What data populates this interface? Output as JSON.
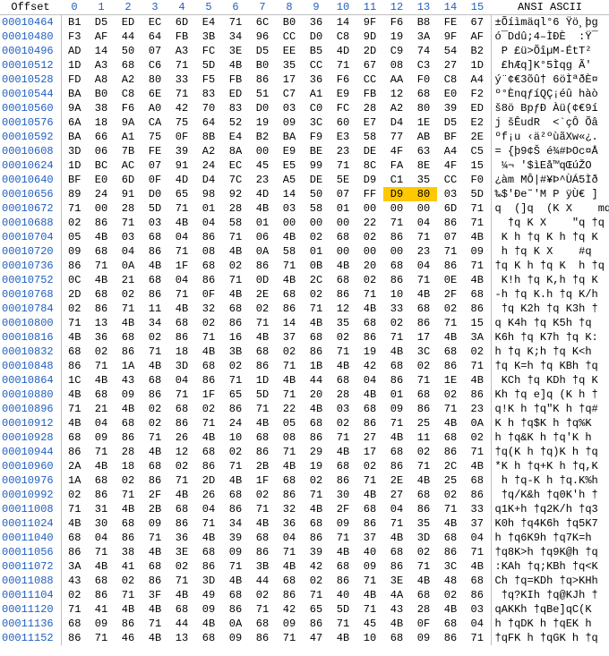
{
  "header": {
    "offset_label": "Offset",
    "columns": [
      "0",
      "1",
      "2",
      "3",
      "4",
      "5",
      "6",
      "7",
      "8",
      "9",
      "10",
      "11",
      "12",
      "13",
      "14",
      "15"
    ],
    "ascii_label": "ANSI ASCII"
  },
  "selection": {
    "row": 12,
    "cols": [
      12,
      13
    ]
  },
  "rows": [
    {
      "offset": "00010464",
      "hex": [
        "B1",
        "D5",
        "ED",
        "EC",
        "6D",
        "E4",
        "71",
        "6C",
        "B0",
        "36",
        "14",
        "9F",
        "F6",
        "B8",
        "FE",
        "67"
      ],
      "ascii": "±Õíìmäql°6 Ÿö¸þg"
    },
    {
      "offset": "00010480",
      "hex": [
        "F3",
        "AF",
        "44",
        "64",
        "FB",
        "3B",
        "34",
        "96",
        "CC",
        "D0",
        "C8",
        "9D",
        "19",
        "3A",
        "9F",
        "AF"
      ],
      "ascii": "ó¯Ddû;4–ÌÐÈ  :Ÿ¯"
    },
    {
      "offset": "00010496",
      "hex": [
        "AD",
        "14",
        "50",
        "07",
        "A3",
        "FC",
        "3E",
        "D5",
        "EE",
        "B5",
        "4D",
        "2D",
        "C9",
        "74",
        "54",
        "B2"
      ],
      "ascii": "­ P £ü>ÕîµM-ÉtT²"
    },
    {
      "offset": "00010512",
      "hex": [
        "1D",
        "A3",
        "68",
        "C6",
        "71",
        "5D",
        "4B",
        "B0",
        "35",
        "CC",
        "71",
        "67",
        "08",
        "C3",
        "27",
        "1D"
      ],
      "ascii": " £hÆq]K°5Ìqg Ã' "
    },
    {
      "offset": "00010528",
      "hex": [
        "FD",
        "A8",
        "A2",
        "80",
        "33",
        "F5",
        "FB",
        "86",
        "17",
        "36",
        "F6",
        "CC",
        "AA",
        "F0",
        "C8",
        "A4"
      ],
      "ascii": "ý¨¢€3õû† 6öÌªðÈ¤"
    },
    {
      "offset": "00010544",
      "hex": [
        "BA",
        "B0",
        "C8",
        "6E",
        "71",
        "83",
        "ED",
        "51",
        "C7",
        "A1",
        "E9",
        "FB",
        "12",
        "68",
        "E0",
        "F2"
      ],
      "ascii": "º°ÈnqƒíQÇ¡éû hàò"
    },
    {
      "offset": "00010560",
      "hex": [
        "9A",
        "38",
        "F6",
        "A0",
        "42",
        "70",
        "83",
        "D0",
        "03",
        "C0",
        "FC",
        "28",
        "A2",
        "80",
        "39",
        "ED"
      ],
      "ascii": "š8ö BpƒÐ Àü(¢€9í"
    },
    {
      "offset": "00010576",
      "hex": [
        "6A",
        "18",
        "9A",
        "CA",
        "75",
        "64",
        "52",
        "19",
        "09",
        "3C",
        "60",
        "E7",
        "D4",
        "1E",
        "D5",
        "E2"
      ],
      "ascii": "j šÊudR  <`çÔ Õâ"
    },
    {
      "offset": "00010592",
      "hex": [
        "BA",
        "66",
        "A1",
        "75",
        "0F",
        "8B",
        "E4",
        "B2",
        "BA",
        "F9",
        "E3",
        "58",
        "77",
        "AB",
        "BF",
        "2E"
      ],
      "ascii": "ºf¡u ‹ä²ºùãXw«¿."
    },
    {
      "offset": "00010608",
      "hex": [
        "3D",
        "06",
        "7B",
        "FE",
        "39",
        "A2",
        "8A",
        "00",
        "E9",
        "BE",
        "23",
        "DE",
        "4F",
        "63",
        "A4",
        "C5"
      ],
      "ascii": "= {þ9¢Š é¾#ÞOc¤Å"
    },
    {
      "offset": "00010624",
      "hex": [
        "1D",
        "BC",
        "AC",
        "07",
        "91",
        "24",
        "EC",
        "45",
        "E5",
        "99",
        "71",
        "8C",
        "FA",
        "8E",
        "4F",
        "15"
      ],
      "ascii": " ¼¬ '$ìEå™qŒúŽO "
    },
    {
      "offset": "00010640",
      "hex": [
        "BF",
        "E0",
        "6D",
        "0F",
        "4D",
        "D4",
        "7C",
        "23",
        "A5",
        "DE",
        "5E",
        "D9",
        "C1",
        "35",
        "CC",
        "F0"
      ],
      "ascii": "¿àm MÔ|#¥Þ^ÙÁ5Ìð"
    },
    {
      "offset": "00010656",
      "hex": [
        "89",
        "24",
        "91",
        "D0",
        "65",
        "98",
        "92",
        "4D",
        "14",
        "50",
        "07",
        "FF",
        "D9",
        "80",
        "03",
        "5D"
      ],
      "ascii": "‰$'Ðe˜'M P ÿÙ€ ]"
    },
    {
      "offset": "00010672",
      "hex": [
        "71",
        "00",
        "28",
        "5D",
        "71",
        "01",
        "28",
        "4B",
        "03",
        "58",
        "01",
        "00",
        "00",
        "00",
        "6D",
        "71"
      ],
      "ascii": "q  (]q  (K X    mq"
    },
    {
      "offset": "00010688",
      "hex": [
        "02",
        "86",
        "71",
        "03",
        "4B",
        "04",
        "58",
        "01",
        "00",
        "00",
        "00",
        "22",
        "71",
        "04",
        "86",
        "71"
      ],
      "ascii": "  †q K X    \"q †q"
    },
    {
      "offset": "00010704",
      "hex": [
        "05",
        "4B",
        "03",
        "68",
        "04",
        "86",
        "71",
        "06",
        "4B",
        "02",
        "68",
        "02",
        "86",
        "71",
        "07",
        "4B"
      ],
      "ascii": " K h †q K h †q K"
    },
    {
      "offset": "00010720",
      "hex": [
        "09",
        "68",
        "04",
        "86",
        "71",
        "08",
        "4B",
        "0A",
        "58",
        "01",
        "00",
        "00",
        "00",
        "23",
        "71",
        "09"
      ],
      "ascii": " h †q K X    #q "
    },
    {
      "offset": "00010736",
      "hex": [
        "86",
        "71",
        "0A",
        "4B",
        "1F",
        "68",
        "02",
        "86",
        "71",
        "0B",
        "4B",
        "20",
        "68",
        "04",
        "86",
        "71"
      ],
      "ascii": "†q K h †q K  h †q"
    },
    {
      "offset": "00010752",
      "hex": [
        "0C",
        "4B",
        "21",
        "68",
        "04",
        "86",
        "71",
        "0D",
        "4B",
        "2C",
        "68",
        "02",
        "86",
        "71",
        "0E",
        "4B"
      ],
      "ascii": " K!h †q K,h †q K"
    },
    {
      "offset": "00010768",
      "hex": [
        "2D",
        "68",
        "02",
        "86",
        "71",
        "0F",
        "4B",
        "2E",
        "68",
        "02",
        "86",
        "71",
        "10",
        "4B",
        "2F",
        "68"
      ],
      "ascii": "-h †q K.h †q K/h"
    },
    {
      "offset": "00010784",
      "hex": [
        "02",
        "86",
        "71",
        "11",
        "4B",
        "32",
        "68",
        "02",
        "86",
        "71",
        "12",
        "4B",
        "33",
        "68",
        "02",
        "86"
      ],
      "ascii": " †q K2h †q K3h †"
    },
    {
      "offset": "00010800",
      "hex": [
        "71",
        "13",
        "4B",
        "34",
        "68",
        "02",
        "86",
        "71",
        "14",
        "4B",
        "35",
        "68",
        "02",
        "86",
        "71",
        "15"
      ],
      "ascii": "q K4h †q K5h †q "
    },
    {
      "offset": "00010816",
      "hex": [
        "4B",
        "36",
        "68",
        "02",
        "86",
        "71",
        "16",
        "4B",
        "37",
        "68",
        "02",
        "86",
        "71",
        "17",
        "4B",
        "3A"
      ],
      "ascii": "K6h †q K7h †q K:"
    },
    {
      "offset": "00010832",
      "hex": [
        "68",
        "02",
        "86",
        "71",
        "18",
        "4B",
        "3B",
        "68",
        "02",
        "86",
        "71",
        "19",
        "4B",
        "3C",
        "68",
        "02"
      ],
      "ascii": "h †q K;h †q K<h "
    },
    {
      "offset": "00010848",
      "hex": [
        "86",
        "71",
        "1A",
        "4B",
        "3D",
        "68",
        "02",
        "86",
        "71",
        "1B",
        "4B",
        "42",
        "68",
        "02",
        "86",
        "71"
      ],
      "ascii": "†q K=h †q KBh †q"
    },
    {
      "offset": "00010864",
      "hex": [
        "1C",
        "4B",
        "43",
        "68",
        "04",
        "86",
        "71",
        "1D",
        "4B",
        "44",
        "68",
        "04",
        "86",
        "71",
        "1E",
        "4B"
      ],
      "ascii": " KCh †q KDh †q K"
    },
    {
      "offset": "00010880",
      "hex": [
        "4B",
        "68",
        "09",
        "86",
        "71",
        "1F",
        "65",
        "5D",
        "71",
        "20",
        "28",
        "4B",
        "01",
        "68",
        "02",
        "86"
      ],
      "ascii": "Kh †q e]q (K h †"
    },
    {
      "offset": "00010896",
      "hex": [
        "71",
        "21",
        "4B",
        "02",
        "68",
        "02",
        "86",
        "71",
        "22",
        "4B",
        "03",
        "68",
        "09",
        "86",
        "71",
        "23"
      ],
      "ascii": "q!K h †q\"K h †q#"
    },
    {
      "offset": "00010912",
      "hex": [
        "4B",
        "04",
        "68",
        "02",
        "86",
        "71",
        "24",
        "4B",
        "05",
        "68",
        "02",
        "86",
        "71",
        "25",
        "4B",
        "0A"
      ],
      "ascii": "K h †q$K h †q%K "
    },
    {
      "offset": "00010928",
      "hex": [
        "68",
        "09",
        "86",
        "71",
        "26",
        "4B",
        "10",
        "68",
        "08",
        "86",
        "71",
        "27",
        "4B",
        "11",
        "68",
        "02"
      ],
      "ascii": "h †q&K h †q'K h "
    },
    {
      "offset": "00010944",
      "hex": [
        "86",
        "71",
        "28",
        "4B",
        "12",
        "68",
        "02",
        "86",
        "71",
        "29",
        "4B",
        "17",
        "68",
        "02",
        "86",
        "71"
      ],
      "ascii": "†q(K h †q)K h †q"
    },
    {
      "offset": "00010960",
      "hex": [
        "2A",
        "4B",
        "18",
        "68",
        "02",
        "86",
        "71",
        "2B",
        "4B",
        "19",
        "68",
        "02",
        "86",
        "71",
        "2C",
        "4B"
      ],
      "ascii": "*K h †q+K h †q,K"
    },
    {
      "offset": "00010976",
      "hex": [
        "1A",
        "68",
        "02",
        "86",
        "71",
        "2D",
        "4B",
        "1F",
        "68",
        "02",
        "86",
        "71",
        "2E",
        "4B",
        "25",
        "68"
      ],
      "ascii": " h †q-K h †q.K%h"
    },
    {
      "offset": "00010992",
      "hex": [
        "02",
        "86",
        "71",
        "2F",
        "4B",
        "26",
        "68",
        "02",
        "86",
        "71",
        "30",
        "4B",
        "27",
        "68",
        "02",
        "86"
      ],
      "ascii": " †q/K&h †q0K'h †"
    },
    {
      "offset": "00011008",
      "hex": [
        "71",
        "31",
        "4B",
        "2B",
        "68",
        "04",
        "86",
        "71",
        "32",
        "4B",
        "2F",
        "68",
        "04",
        "86",
        "71",
        "33"
      ],
      "ascii": "q1K+h †q2K/h †q3"
    },
    {
      "offset": "00011024",
      "hex": [
        "4B",
        "30",
        "68",
        "09",
        "86",
        "71",
        "34",
        "4B",
        "36",
        "68",
        "09",
        "86",
        "71",
        "35",
        "4B",
        "37"
      ],
      "ascii": "K0h †q4K6h †q5K7"
    },
    {
      "offset": "00011040",
      "hex": [
        "68",
        "04",
        "86",
        "71",
        "36",
        "4B",
        "39",
        "68",
        "04",
        "86",
        "71",
        "37",
        "4B",
        "3D",
        "68",
        "04"
      ],
      "ascii": "h †q6K9h †q7K=h "
    },
    {
      "offset": "00011056",
      "hex": [
        "86",
        "71",
        "38",
        "4B",
        "3E",
        "68",
        "09",
        "86",
        "71",
        "39",
        "4B",
        "40",
        "68",
        "02",
        "86",
        "71"
      ],
      "ascii": "†q8K>h †q9K@h †q"
    },
    {
      "offset": "00011072",
      "hex": [
        "3A",
        "4B",
        "41",
        "68",
        "02",
        "86",
        "71",
        "3B",
        "4B",
        "42",
        "68",
        "09",
        "86",
        "71",
        "3C",
        "4B"
      ],
      "ascii": ":KAh †q;KBh †q<K"
    },
    {
      "offset": "00011088",
      "hex": [
        "43",
        "68",
        "02",
        "86",
        "71",
        "3D",
        "4B",
        "44",
        "68",
        "02",
        "86",
        "71",
        "3E",
        "4B",
        "48",
        "68"
      ],
      "ascii": "Ch †q=KDh †q>KHh"
    },
    {
      "offset": "00011104",
      "hex": [
        "02",
        "86",
        "71",
        "3F",
        "4B",
        "49",
        "68",
        "02",
        "86",
        "71",
        "40",
        "4B",
        "4A",
        "68",
        "02",
        "86"
      ],
      "ascii": " †q?KIh †q@KJh †"
    },
    {
      "offset": "00011120",
      "hex": [
        "71",
        "41",
        "4B",
        "4B",
        "68",
        "09",
        "86",
        "71",
        "42",
        "65",
        "5D",
        "71",
        "43",
        "28",
        "4B",
        "03"
      ],
      "ascii": "qAKKh †qBe]qC(K "
    },
    {
      "offset": "00011136",
      "hex": [
        "68",
        "09",
        "86",
        "71",
        "44",
        "4B",
        "0A",
        "68",
        "09",
        "86",
        "71",
        "45",
        "4B",
        "0F",
        "68",
        "04"
      ],
      "ascii": "h †qDK h †qEK h "
    },
    {
      "offset": "00011152",
      "hex": [
        "86",
        "71",
        "46",
        "4B",
        "13",
        "68",
        "09",
        "86",
        "71",
        "47",
        "4B",
        "10",
        "68",
        "09",
        "86",
        "71"
      ],
      "ascii": "†qFK h †qGK h †q"
    }
  ]
}
